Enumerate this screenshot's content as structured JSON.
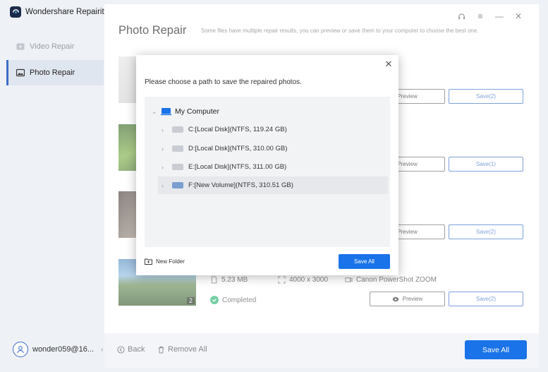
{
  "app": {
    "title": "Wondershare Repairit"
  },
  "sidebar": {
    "items": [
      {
        "label": "Video Repair",
        "icon": "video-icon",
        "active": false
      },
      {
        "label": "Photo Repair",
        "icon": "image-icon",
        "active": true
      }
    ],
    "user": {
      "name": "wonder059@16..."
    }
  },
  "header": {
    "title": "Photo Repair",
    "subtitle": "Some files have multiple repair results, you can preview or save them to your computer to choose the best one."
  },
  "rows": [
    {
      "preview_label": "Preview",
      "save_label": "Save(2)"
    },
    {
      "preview_label": "Preview",
      "save_label": "Save(1)"
    },
    {
      "preview_label": "Preview",
      "save_label": "Save(2)"
    },
    {
      "preview_label": "Preview",
      "save_label": "Save(2)",
      "file_size": "5.23  MB",
      "resolution": "4000 x 3000",
      "camera": "Canon PowerShot ZOOM",
      "status": "Completed",
      "result_count": "2"
    }
  ],
  "footer": {
    "back_label": "Back",
    "remove_all_label": "Remove All",
    "save_all_label": "Save All"
  },
  "dialog": {
    "title": "Please choose a path to save the repaired photos.",
    "root_label": "My Computer",
    "drives": [
      {
        "label": "C:[Local Disk](NTFS, 119.24  GB)",
        "selected": false
      },
      {
        "label": "D:[Local Disk](NTFS, 310.00  GB)",
        "selected": false
      },
      {
        "label": "E:[Local Disk](NTFS, 311.00  GB)",
        "selected": false
      },
      {
        "label": "F:[New Volume](NTFS, 310.51  GB)",
        "selected": true
      }
    ],
    "new_folder_label": "New Folder",
    "save_all_label": "Save All"
  },
  "colors": {
    "accent": "#1a73e8",
    "success": "#2bb673",
    "sidebar_bg": "#eef1f6"
  }
}
